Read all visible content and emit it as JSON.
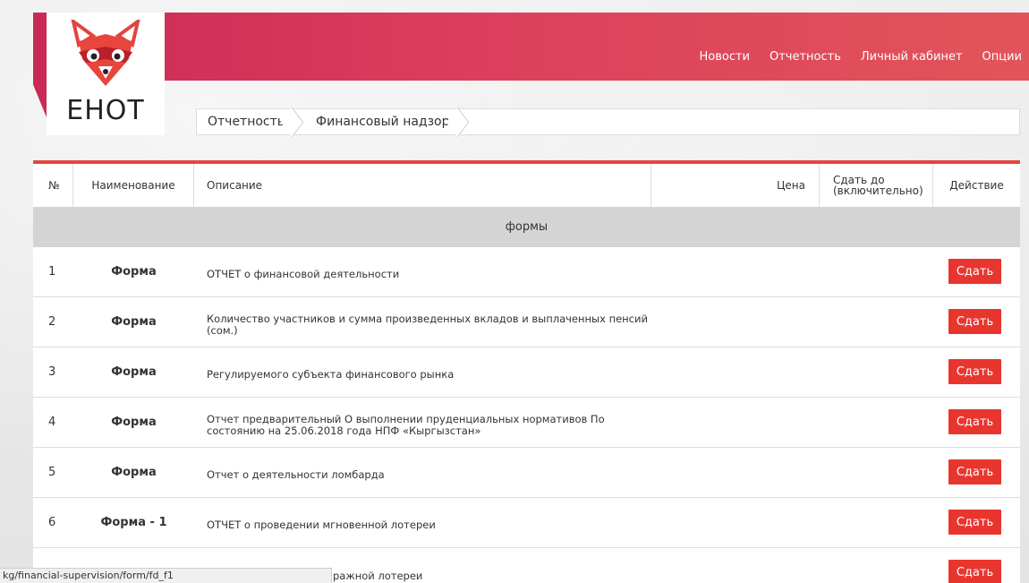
{
  "logo": {
    "text": "ЕНОТ",
    "icon": "raccoon-logo-icon"
  },
  "nav": [
    "Новости",
    "Отчетность",
    "Личный кабинет",
    "Опции"
  ],
  "breadcrumb": [
    "Отчетность",
    "Финансовый надзор"
  ],
  "table": {
    "headers": {
      "num": "№",
      "name": "Наименование",
      "desc": "Описание",
      "price": "Цена",
      "due": "Сдать до (включительно)",
      "action": "Действие"
    },
    "section": "формы",
    "rows": [
      {
        "num": "1",
        "name": "Форма",
        "desc": "ОТЧЕТ о финансовой деятельности",
        "action": "Сдать"
      },
      {
        "num": "2",
        "name": "Форма",
        "desc": "Количество участников и сумма произведенных вкладов и выплаченных пенсий (сом.)",
        "action": "Сдать"
      },
      {
        "num": "3",
        "name": "Форма",
        "desc": "Регулируемого субъекта финансового рынка",
        "action": "Сдать"
      },
      {
        "num": "4",
        "name": "Форма",
        "desc": "Отчет предварительный О выполнении пруденциальных нормативов По состоянию на 25.06.2018 года НПФ «Кыргызстан»",
        "action": "Сдать"
      },
      {
        "num": "5",
        "name": "Форма",
        "desc": "Отчет о деятельности ломбарда",
        "action": "Сдать"
      },
      {
        "num": "6",
        "name": "Форма - 1",
        "desc": "ОТЧЕТ о проведении мгновенной лотереи",
        "action": "Сдать"
      },
      {
        "num": "",
        "name": "",
        "desc": "ражной лотереи",
        "action": "Сдать"
      }
    ]
  },
  "status_url": "kg/financial-supervision/form/fd_f1",
  "colors": {
    "header_start": "#c92a55",
    "header_end": "#e2545a",
    "accent": "#e8362f",
    "section_bg": "#d4d4d4"
  }
}
